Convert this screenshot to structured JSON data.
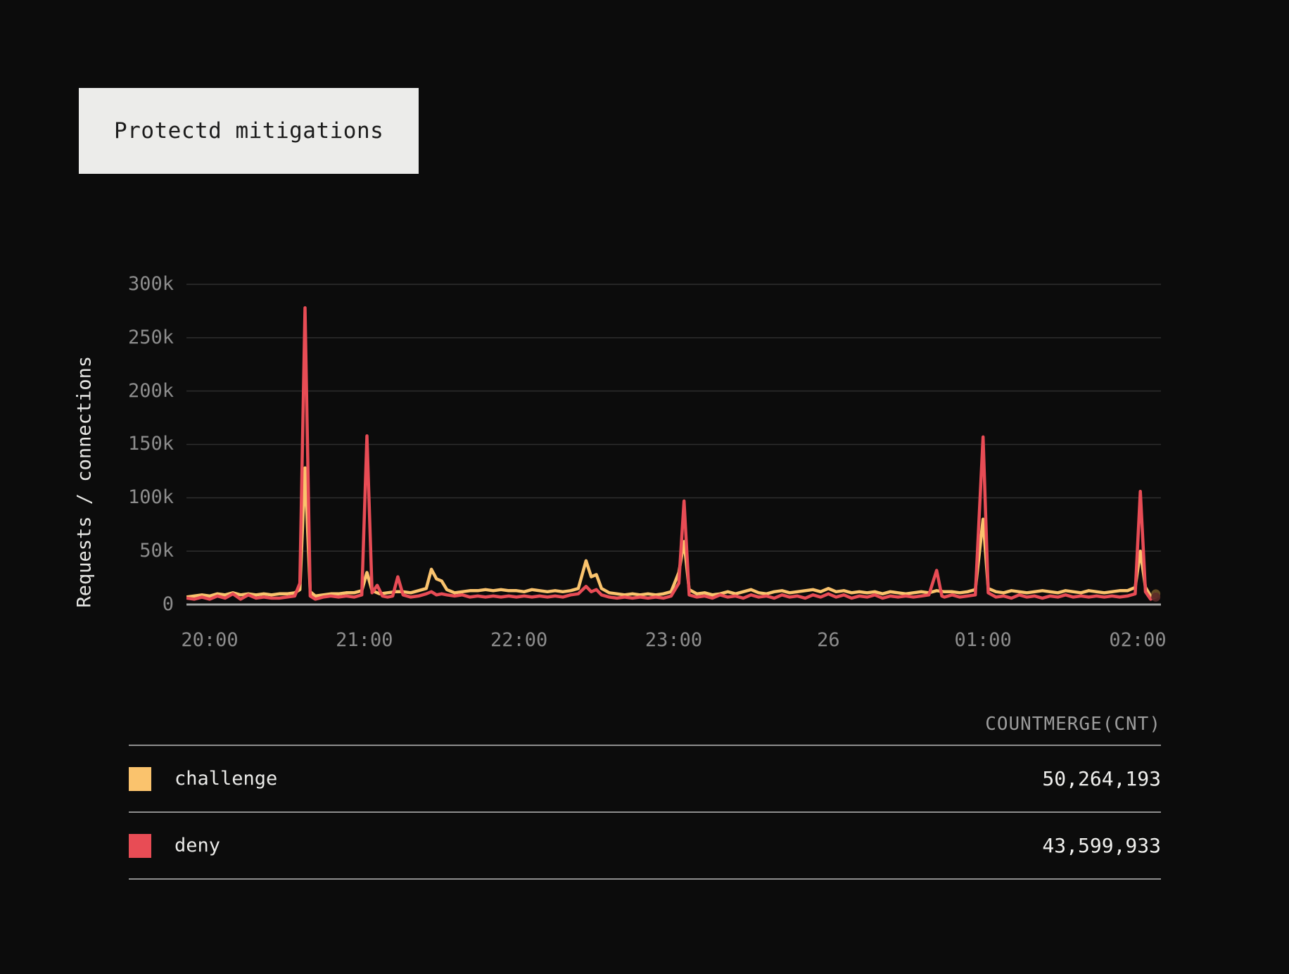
{
  "title_box": {
    "title": "Protectd mitigations"
  },
  "chart_data": {
    "type": "line",
    "title": "Protectd mitigations",
    "ylabel": "Requests / connections",
    "xlabel": "",
    "grid": "horizontal-only",
    "legend_position": "table-below",
    "x_unit": "minutes-from-left-edge (left edge ≈ 19:51, right edge ≈ 02:09, day changes at tick labeled 26)",
    "value_unit": "thousands of requests (k)",
    "x_range": [
      0,
      378
    ],
    "ylim": [
      0,
      310
    ],
    "y_ticks": [
      {
        "v": 0,
        "label": "0"
      },
      {
        "v": 50,
        "label": "50k"
      },
      {
        "v": 100,
        "label": "100k"
      },
      {
        "v": 150,
        "label": "150k"
      },
      {
        "v": 200,
        "label": "200k"
      },
      {
        "v": 250,
        "label": "250k"
      },
      {
        "v": 300,
        "label": "300k"
      }
    ],
    "x_ticks": [
      {
        "t": 9,
        "label": "20:00"
      },
      {
        "t": 69,
        "label": "21:00"
      },
      {
        "t": 129,
        "label": "22:00"
      },
      {
        "t": 189,
        "label": "23:00"
      },
      {
        "t": 249,
        "label": "26"
      },
      {
        "t": 309,
        "label": "01:00"
      },
      {
        "t": 369,
        "label": "02:00"
      }
    ],
    "peaks_note": "main spikes: deny 278k @ ~20:37, 158k @ ~21:01, 97k @ ~23:04, 32k @ ~00:42, 157k @ ~01:00, 106k @ ~02:00; challenge 128k @ ~20:37, 41k @ ~22:26, 59k @ ~23:04, 80k @ ~01:00, 50k @ ~02:00",
    "series": [
      {
        "name": "challenge",
        "color": "#fac36d",
        "end_dot_color": "#6b5126",
        "points": [
          [
            0,
            7
          ],
          [
            3,
            8
          ],
          [
            6,
            9
          ],
          [
            9,
            8
          ],
          [
            12,
            10
          ],
          [
            15,
            9
          ],
          [
            18,
            11
          ],
          [
            21,
            9
          ],
          [
            24,
            10
          ],
          [
            27,
            9
          ],
          [
            30,
            10
          ],
          [
            33,
            9
          ],
          [
            36,
            10
          ],
          [
            39,
            10
          ],
          [
            42,
            11
          ],
          [
            44,
            14
          ],
          [
            46,
            128
          ],
          [
            48,
            12
          ],
          [
            50,
            8
          ],
          [
            53,
            9
          ],
          [
            56,
            10
          ],
          [
            59,
            10
          ],
          [
            62,
            11
          ],
          [
            65,
            11
          ],
          [
            68,
            13
          ],
          [
            70,
            30
          ],
          [
            72,
            13
          ],
          [
            75,
            10
          ],
          [
            78,
            11
          ],
          [
            81,
            12
          ],
          [
            84,
            12
          ],
          [
            87,
            11
          ],
          [
            90,
            13
          ],
          [
            93,
            15
          ],
          [
            95,
            33
          ],
          [
            97,
            24
          ],
          [
            99,
            22
          ],
          [
            101,
            14
          ],
          [
            104,
            11
          ],
          [
            107,
            12
          ],
          [
            110,
            13
          ],
          [
            113,
            13
          ],
          [
            116,
            14
          ],
          [
            119,
            13
          ],
          [
            122,
            14
          ],
          [
            125,
            13
          ],
          [
            128,
            13
          ],
          [
            131,
            12
          ],
          [
            134,
            14
          ],
          [
            137,
            13
          ],
          [
            140,
            12
          ],
          [
            143,
            13
          ],
          [
            146,
            12
          ],
          [
            149,
            13
          ],
          [
            152,
            15
          ],
          [
            155,
            41
          ],
          [
            157,
            26
          ],
          [
            159,
            28
          ],
          [
            161,
            15
          ],
          [
            164,
            11
          ],
          [
            167,
            10
          ],
          [
            170,
            9
          ],
          [
            173,
            10
          ],
          [
            176,
            9
          ],
          [
            179,
            10
          ],
          [
            182,
            9
          ],
          [
            185,
            10
          ],
          [
            188,
            12
          ],
          [
            191,
            30
          ],
          [
            193,
            59
          ],
          [
            195,
            14
          ],
          [
            198,
            10
          ],
          [
            201,
            11
          ],
          [
            204,
            9
          ],
          [
            207,
            10
          ],
          [
            210,
            12
          ],
          [
            213,
            10
          ],
          [
            216,
            12
          ],
          [
            219,
            14
          ],
          [
            222,
            11
          ],
          [
            225,
            10
          ],
          [
            228,
            12
          ],
          [
            231,
            13
          ],
          [
            234,
            11
          ],
          [
            237,
            12
          ],
          [
            240,
            13
          ],
          [
            243,
            14
          ],
          [
            246,
            12
          ],
          [
            249,
            15
          ],
          [
            252,
            12
          ],
          [
            255,
            13
          ],
          [
            258,
            11
          ],
          [
            261,
            12
          ],
          [
            264,
            11
          ],
          [
            267,
            12
          ],
          [
            270,
            10
          ],
          [
            273,
            12
          ],
          [
            276,
            11
          ],
          [
            279,
            10
          ],
          [
            282,
            11
          ],
          [
            285,
            12
          ],
          [
            288,
            11
          ],
          [
            291,
            13
          ],
          [
            294,
            12
          ],
          [
            297,
            12
          ],
          [
            300,
            11
          ],
          [
            303,
            12
          ],
          [
            306,
            14
          ],
          [
            309,
            80
          ],
          [
            311,
            15
          ],
          [
            314,
            12
          ],
          [
            317,
            11
          ],
          [
            320,
            13
          ],
          [
            323,
            12
          ],
          [
            326,
            11
          ],
          [
            329,
            12
          ],
          [
            332,
            13
          ],
          [
            335,
            12
          ],
          [
            338,
            11
          ],
          [
            341,
            13
          ],
          [
            344,
            12
          ],
          [
            347,
            11
          ],
          [
            350,
            13
          ],
          [
            353,
            12
          ],
          [
            356,
            11
          ],
          [
            359,
            12
          ],
          [
            362,
            13
          ],
          [
            365,
            13
          ],
          [
            368,
            16
          ],
          [
            370,
            50
          ],
          [
            372,
            16
          ],
          [
            374,
            8
          ],
          [
            376,
            10
          ]
        ]
      },
      {
        "name": "deny",
        "color": "#e84c55",
        "end_dot_color": "#5a2a28",
        "points": [
          [
            0,
            6
          ],
          [
            3,
            5
          ],
          [
            6,
            7
          ],
          [
            9,
            5
          ],
          [
            12,
            8
          ],
          [
            15,
            6
          ],
          [
            18,
            10
          ],
          [
            21,
            5
          ],
          [
            24,
            9
          ],
          [
            27,
            6
          ],
          [
            30,
            7
          ],
          [
            33,
            6
          ],
          [
            36,
            6
          ],
          [
            39,
            7
          ],
          [
            42,
            8
          ],
          [
            44,
            20
          ],
          [
            46,
            278
          ],
          [
            48,
            8
          ],
          [
            50,
            5
          ],
          [
            53,
            7
          ],
          [
            56,
            8
          ],
          [
            59,
            7
          ],
          [
            62,
            8
          ],
          [
            65,
            7
          ],
          [
            68,
            9
          ],
          [
            70,
            158
          ],
          [
            72,
            11
          ],
          [
            74,
            18
          ],
          [
            76,
            8
          ],
          [
            78,
            7
          ],
          [
            80,
            8
          ],
          [
            82,
            26
          ],
          [
            84,
            9
          ],
          [
            87,
            7
          ],
          [
            90,
            8
          ],
          [
            93,
            10
          ],
          [
            95,
            12
          ],
          [
            97,
            9
          ],
          [
            99,
            10
          ],
          [
            101,
            9
          ],
          [
            104,
            8
          ],
          [
            107,
            9
          ],
          [
            110,
            7
          ],
          [
            113,
            8
          ],
          [
            116,
            7
          ],
          [
            119,
            8
          ],
          [
            122,
            7
          ],
          [
            125,
            8
          ],
          [
            128,
            7
          ],
          [
            131,
            8
          ],
          [
            134,
            7
          ],
          [
            137,
            8
          ],
          [
            140,
            7
          ],
          [
            143,
            8
          ],
          [
            146,
            7
          ],
          [
            149,
            9
          ],
          [
            152,
            10
          ],
          [
            155,
            17
          ],
          [
            157,
            12
          ],
          [
            159,
            14
          ],
          [
            161,
            9
          ],
          [
            164,
            7
          ],
          [
            167,
            6
          ],
          [
            170,
            7
          ],
          [
            173,
            6
          ],
          [
            176,
            7
          ],
          [
            179,
            6
          ],
          [
            182,
            7
          ],
          [
            185,
            6
          ],
          [
            188,
            8
          ],
          [
            191,
            20
          ],
          [
            193,
            97
          ],
          [
            195,
            9
          ],
          [
            198,
            7
          ],
          [
            201,
            8
          ],
          [
            204,
            6
          ],
          [
            207,
            9
          ],
          [
            210,
            7
          ],
          [
            213,
            8
          ],
          [
            216,
            6
          ],
          [
            219,
            9
          ],
          [
            222,
            7
          ],
          [
            225,
            8
          ],
          [
            228,
            6
          ],
          [
            231,
            9
          ],
          [
            234,
            7
          ],
          [
            237,
            8
          ],
          [
            240,
            6
          ],
          [
            243,
            9
          ],
          [
            246,
            7
          ],
          [
            249,
            10
          ],
          [
            252,
            7
          ],
          [
            255,
            9
          ],
          [
            258,
            6
          ],
          [
            261,
            8
          ],
          [
            264,
            7
          ],
          [
            267,
            9
          ],
          [
            270,
            6
          ],
          [
            273,
            8
          ],
          [
            276,
            7
          ],
          [
            279,
            8
          ],
          [
            282,
            7
          ],
          [
            285,
            8
          ],
          [
            288,
            9
          ],
          [
            291,
            32
          ],
          [
            293,
            8
          ],
          [
            294,
            7
          ],
          [
            297,
            9
          ],
          [
            300,
            7
          ],
          [
            303,
            8
          ],
          [
            306,
            9
          ],
          [
            309,
            157
          ],
          [
            311,
            11
          ],
          [
            314,
            7
          ],
          [
            317,
            8
          ],
          [
            320,
            6
          ],
          [
            323,
            9
          ],
          [
            326,
            7
          ],
          [
            329,
            8
          ],
          [
            332,
            6
          ],
          [
            335,
            8
          ],
          [
            338,
            7
          ],
          [
            341,
            9
          ],
          [
            344,
            7
          ],
          [
            347,
            8
          ],
          [
            350,
            7
          ],
          [
            353,
            8
          ],
          [
            356,
            7
          ],
          [
            359,
            8
          ],
          [
            362,
            7
          ],
          [
            365,
            8
          ],
          [
            368,
            10
          ],
          [
            370,
            106
          ],
          [
            372,
            12
          ],
          [
            374,
            5
          ],
          [
            376,
            7
          ]
        ]
      }
    ]
  },
  "legend": {
    "header": "COUNTMERGE(CNT)",
    "rows": [
      {
        "label": "challenge",
        "value": "50,264,193",
        "color": "#fac36d"
      },
      {
        "label": "deny",
        "value": "43,599,933",
        "color": "#e84c55"
      }
    ]
  },
  "colors": {
    "background": "#0c0c0c",
    "title_box_bg": "#ececea",
    "title_text": "#1c1c1c",
    "gridline": "#2e2e2e",
    "axis_baseline": "#a6a6a6",
    "tick_text": "#8d8d8d",
    "legend_text": "#eaeae8",
    "separator": "#8f8f8f"
  }
}
